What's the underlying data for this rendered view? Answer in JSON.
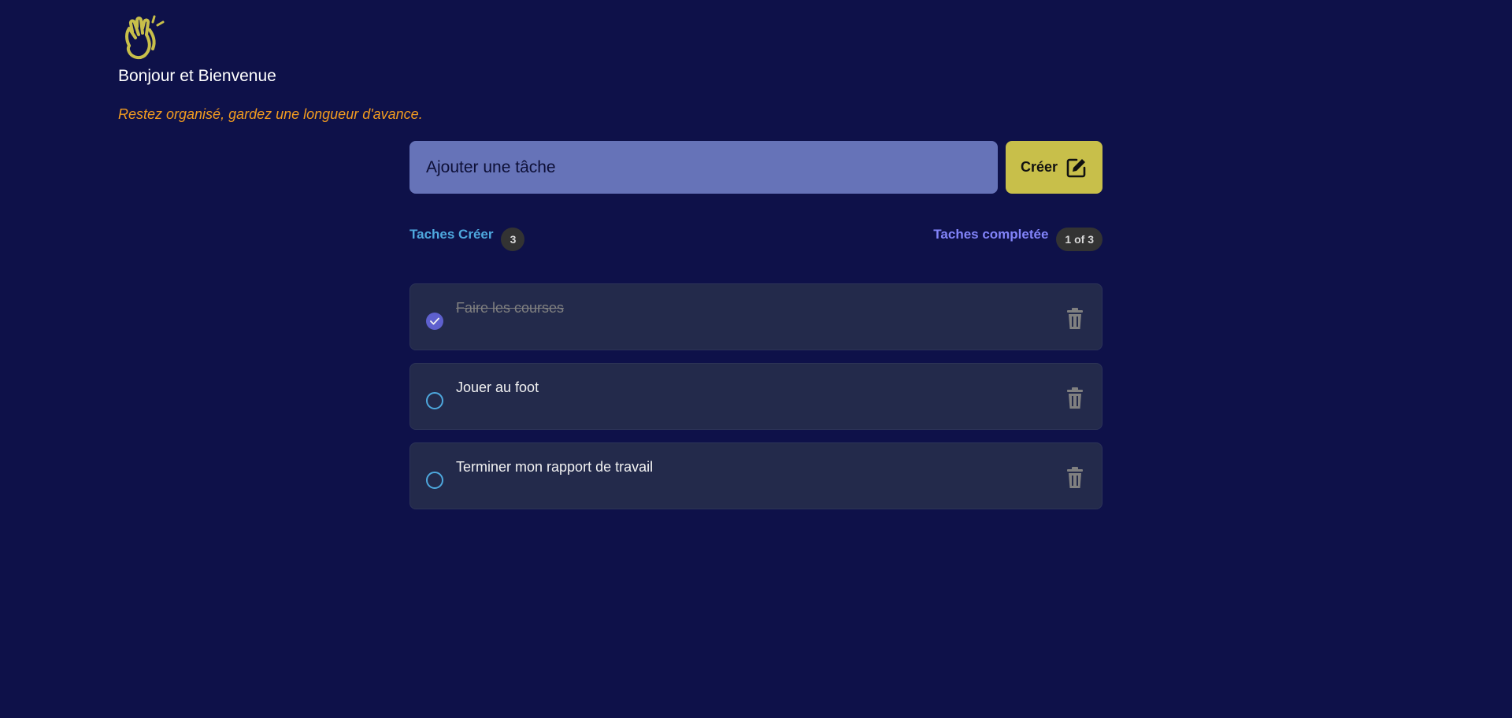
{
  "header": {
    "logo_icon": "clapping-hands-icon",
    "greeting": "Bonjour et Bienvenue",
    "tagline": "Restez organisé, gardez une longueur d'avance."
  },
  "add_task": {
    "placeholder": "Ajouter une tâche",
    "value": "",
    "button_label": "Créer",
    "button_icon": "edit-icon"
  },
  "stats": {
    "created_label": "Taches Créer",
    "created_count": "3",
    "completed_label": "Taches completée",
    "completed_count": "1 of 3"
  },
  "tasks": [
    {
      "text": "Faire les courses",
      "done": true
    },
    {
      "text": "Jouer au foot",
      "done": false
    },
    {
      "text": "Terminer mon rapport de travail",
      "done": false
    }
  ],
  "colors": {
    "background": "#0e1149",
    "accent_yellow": "#c8bf4a",
    "input_bg": "#6673b8",
    "tagline": "#f39c1f",
    "created_label": "#4ea8de",
    "completed_label": "#8284fa",
    "card_bg": "#232a4b",
    "check_done": "#5e60ce"
  }
}
